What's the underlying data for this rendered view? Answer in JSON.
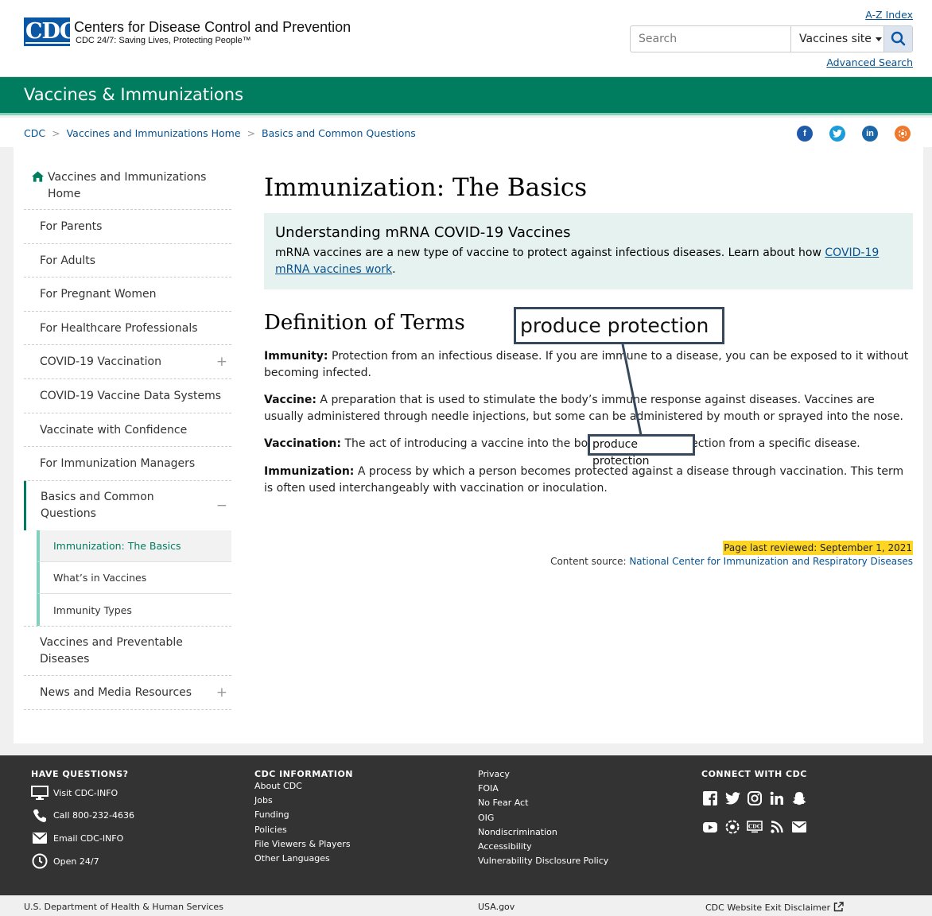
{
  "header": {
    "logo_text": "CDC",
    "org_name": "Centers for Disease Control and Prevention",
    "tagline": "CDC 24/7: Saving Lives, Protecting People™",
    "az_index": "A-Z Index",
    "search_placeholder": "Search",
    "search_scope": "Vaccines site",
    "advanced_search": "Advanced Search"
  },
  "site_title": "Vaccines & Immunizations",
  "breadcrumb": [
    "CDC",
    "Vaccines and Immunizations Home",
    "Basics and Common Questions"
  ],
  "share_icons": [
    "facebook-icon",
    "twitter-icon",
    "linkedin-icon",
    "syndicate-icon"
  ],
  "sidenav": {
    "home": "Vaccines and Immunizations Home",
    "items": [
      "For Parents",
      "For Adults",
      "For Pregnant Women",
      "For Healthcare Professionals",
      "COVID-19 Vaccination",
      "COVID-19 Vaccine Data Systems",
      "Vaccinate with Confidence",
      "For Immunization Managers",
      "Basics and Common Questions",
      "Vaccines and Preventable Diseases",
      "News and Media Resources"
    ],
    "sub_items": [
      "Immunization: The Basics",
      "What’s in Vaccines",
      "Immunity Types"
    ],
    "plus": "+",
    "minus": "−"
  },
  "main": {
    "title": "Immunization: The Basics",
    "callout_title": "Understanding mRNA COVID-19 Vaccines",
    "callout_text": "mRNA vaccines are a new type of vaccine to protect against infectious diseases. Learn about how ",
    "callout_link": "COVID-19 mRNA vaccines work",
    "callout_end": ".",
    "definitions_heading": "Definition of Terms",
    "terms": [
      {
        "term": "Immunity:",
        "text": " Protection from an infectious disease. If you are immune to a disease, you can be exposed to it without becoming infected."
      },
      {
        "term": "Vaccine:",
        "text": " A preparation that is used to stimulate the body’s immune response against diseases. Vaccines are usually administered through needle injections, but some can be administered by mouth or sprayed into the nose."
      },
      {
        "term": "Vaccination:",
        "text": " The act of introducing a vaccine into the body to produce protection from a specific disease."
      },
      {
        "term": "Immunization:",
        "text": " A process by which a person becomes protected against a disease through vaccination. This term is often used interchangeably with vaccination or inoculation."
      }
    ],
    "annotation": "produce protection",
    "reviewed": "Page last reviewed: September 1, 2021",
    "source_label": "Content source: ",
    "source_link": "National Center for Immunization and Respiratory Diseases"
  },
  "footer": {
    "questions_head": "HAVE QUESTIONS?",
    "contacts": [
      "Visit CDC-INFO",
      "Call 800-232-4636",
      "Email CDC-INFO",
      "Open 24/7"
    ],
    "info_head": "CDC INFORMATION",
    "info_links": [
      "About CDC",
      "Jobs",
      "Funding",
      "Policies",
      "File Viewers & Players",
      "Other Languages"
    ],
    "more_links": [
      "Privacy",
      "FOIA",
      "No Fear Act",
      "OIG",
      "Nondiscrimination",
      "Accessibility",
      "Vulnerability Disclosure Policy"
    ],
    "connect_head": "CONNECT WITH CDC",
    "social": [
      "facebook-icon",
      "twitter-icon",
      "instagram-icon",
      "linkedin-icon",
      "snapchat-icon",
      "youtube-icon",
      "pinterest-icon",
      "cdc-tv-icon",
      "rss-icon",
      "email-icon"
    ]
  },
  "subfooter": {
    "hhs": "U.S. Department of Health & Human Services",
    "usa": "USA.gov",
    "disclaimer": "CDC Website Exit Disclaimer"
  },
  "colors": {
    "brand_blue": "#0b57a4",
    "site_green": "#007c5f",
    "accent_mint": "#7fd3bd",
    "callout_bg": "#e6f2f0",
    "highlight": "#ffd524",
    "footer_bg": "#333333"
  }
}
